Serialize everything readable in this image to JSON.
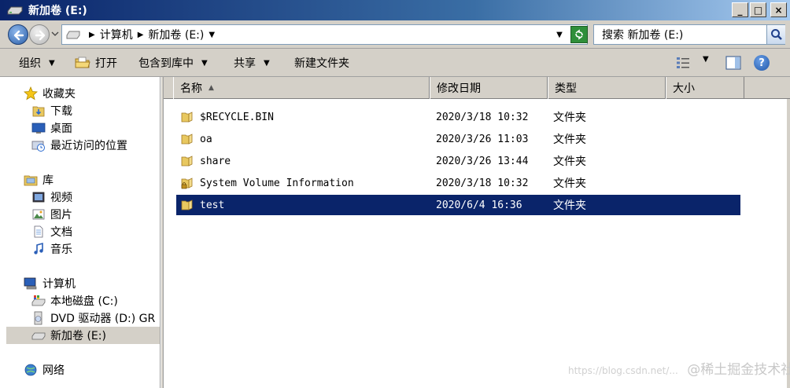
{
  "window": {
    "title": "新加卷 (E:)",
    "buttons": {
      "minimize": "_",
      "maximize": "□",
      "close": "×"
    }
  },
  "address": {
    "crumbs": [
      "计算机",
      "新加卷 (E:)"
    ],
    "search_placeholder": "搜索 新加卷 (E:)"
  },
  "commands": {
    "organize": "组织",
    "open": "打开",
    "include_in_library": "包含到库中",
    "share": "共享",
    "new_folder": "新建文件夹",
    "help": "?"
  },
  "sidebar": {
    "favorites": {
      "label": "收藏夹",
      "items": [
        "下载",
        "桌面",
        "最近访问的位置"
      ]
    },
    "libraries": {
      "label": "库",
      "items": [
        "视频",
        "图片",
        "文档",
        "音乐"
      ]
    },
    "computer": {
      "label": "计算机",
      "items": [
        "本地磁盘 (C:)",
        "DVD 驱动器 (D:) GR",
        "新加卷 (E:)"
      ]
    },
    "network": {
      "label": "网络"
    }
  },
  "columns": {
    "name": "名称",
    "date": "修改日期",
    "type": "类型",
    "size": "大小"
  },
  "files": [
    {
      "name": "$RECYCLE.BIN",
      "date": "2020/3/18 10:32",
      "type": "文件夹"
    },
    {
      "name": "oa",
      "date": "2020/3/26 11:03",
      "type": "文件夹"
    },
    {
      "name": "share",
      "date": "2020/3/26 13:44",
      "type": "文件夹"
    },
    {
      "name": "System Volume Information",
      "date": "2020/3/18 10:32",
      "type": "文件夹"
    },
    {
      "name": "test",
      "date": "2020/6/4 16:36",
      "type": "文件夹"
    }
  ],
  "watermark": {
    "url": "https://blog.csdn.net/...",
    "text": "@稀土掘金技术社区"
  },
  "colors": {
    "selection": "#0a246a",
    "titlebar": "#0a246a",
    "chrome": "#d4d0c8"
  }
}
